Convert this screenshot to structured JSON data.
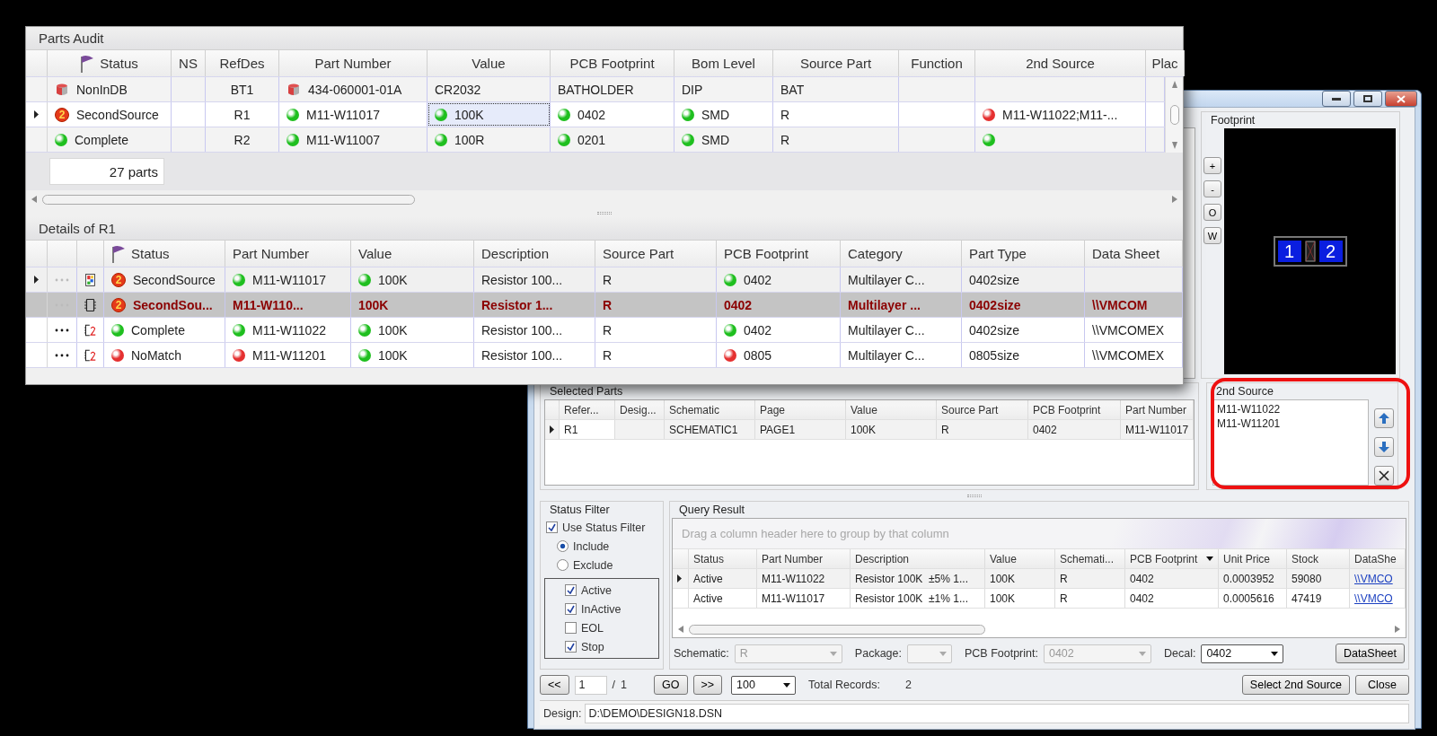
{
  "audit": {
    "title": "Parts Audit",
    "columns": [
      "Status",
      "NS",
      "RefDes",
      "Part Number",
      "Value",
      "PCB Footprint",
      "Bom Level",
      "Source Part",
      "Function",
      "2nd Source",
      "Plac"
    ],
    "rows": [
      {
        "current": false,
        "cells": [
          {
            "kind": "db",
            "text": "NonInDB"
          },
          null,
          {
            "text": "BT1"
          },
          {
            "kind": "db",
            "text": "434-060001-01A"
          },
          {
            "text": "CR2032"
          },
          {
            "text": "BATHOLDER"
          },
          {
            "text": "DIP"
          },
          {
            "text": "BAT"
          },
          null,
          null
        ]
      },
      {
        "current": true,
        "cells": [
          {
            "kind": "badge",
            "badge": "2",
            "text": "SecondSource"
          },
          null,
          {
            "text": "R1"
          },
          {
            "kind": "ok",
            "text": "M11-W11017"
          },
          {
            "kind": "ok",
            "text": "100K",
            "focused": true
          },
          {
            "kind": "ok",
            "text": "0402"
          },
          {
            "kind": "ok",
            "text": "SMD"
          },
          {
            "text": "R"
          },
          null,
          {
            "kind": "bad",
            "text": "M11-W11022;M11-..."
          }
        ]
      },
      {
        "current": false,
        "cells": [
          {
            "kind": "ok",
            "text": "Complete"
          },
          null,
          {
            "text": "R2"
          },
          {
            "kind": "ok",
            "text": "M11-W11007"
          },
          {
            "kind": "ok",
            "text": "100R"
          },
          {
            "kind": "ok",
            "text": "0201"
          },
          {
            "kind": "ok",
            "text": "SMD"
          },
          {
            "text": "R"
          },
          null,
          {
            "kind": "ok"
          }
        ]
      }
    ],
    "count": "27 parts"
  },
  "details": {
    "title": "Details of R1",
    "columns": [
      "Status",
      "Part Number",
      "Value",
      "Description",
      "Source Part",
      "PCB Footprint",
      "Category",
      "Part Type",
      "Data Sheet"
    ],
    "rows": [
      {
        "current": true,
        "selected": false,
        "dots_active": false,
        "kind": "multi",
        "cells": [
          {
            "kind": "badge",
            "badge": "2",
            "text": "SecondSource"
          },
          {
            "kind": "ok",
            "text": "M11-W11017"
          },
          {
            "kind": "ok",
            "text": "100K"
          },
          {
            "text": "Resistor 100..."
          },
          {
            "text": "R"
          },
          {
            "kind": "ok",
            "text": "0402"
          },
          {
            "text": "Multilayer C..."
          },
          {
            "text": "0402size"
          },
          null
        ]
      },
      {
        "current": false,
        "selected": true,
        "dots_active": false,
        "kind": "chip",
        "cells": [
          {
            "kind": "badge",
            "badge": "2",
            "text": "SecondSou..."
          },
          {
            "text": "M11-W110..."
          },
          {
            "text": "100K"
          },
          {
            "text": "Resistor 1..."
          },
          {
            "text": "R"
          },
          {
            "text": "0402"
          },
          {
            "text": "Multilayer ..."
          },
          {
            "text": "0402size"
          },
          {
            "text": "\\\\VMCOM"
          }
        ]
      },
      {
        "current": false,
        "selected": false,
        "dots_active": true,
        "kind": "chip2",
        "cells": [
          {
            "kind": "ok",
            "text": "Complete"
          },
          {
            "kind": "ok",
            "text": "M11-W11022"
          },
          {
            "kind": "ok",
            "text": "100K"
          },
          {
            "text": "Resistor 100..."
          },
          {
            "text": "R"
          },
          {
            "kind": "ok",
            "text": "0402"
          },
          {
            "text": "Multilayer C..."
          },
          {
            "text": "0402size"
          },
          {
            "text": "\\\\VMCOMEX"
          }
        ]
      },
      {
        "current": false,
        "selected": false,
        "dots_active": true,
        "kind": "chip2",
        "cells": [
          {
            "kind": "bad",
            "text": "NoMatch"
          },
          {
            "kind": "bad",
            "text": "M11-W11201"
          },
          {
            "kind": "ok",
            "text": "100K"
          },
          {
            "text": "Resistor 100..."
          },
          {
            "text": "R"
          },
          {
            "kind": "bad",
            "text": "0805"
          },
          {
            "text": "Multilayer C..."
          },
          {
            "text": "0805size"
          },
          {
            "text": "\\\\VMCOMEX"
          }
        ]
      }
    ]
  },
  "dialog": {
    "footprint": {
      "title": "Footprint",
      "zoom_buttons": [
        "+",
        "-",
        "O",
        "W"
      ],
      "pads": [
        "1",
        "2"
      ]
    },
    "selected_parts": {
      "title": "Selected Parts",
      "columns": [
        "Refer...",
        "Desig...",
        "Schematic",
        "Page",
        "Value",
        "Source Part",
        "PCB Footprint",
        "Part Number"
      ],
      "rows": [
        {
          "current": true,
          "cells": [
            "R1",
            null,
            "SCHEMATIC1",
            "PAGE1",
            "100K",
            "R",
            "0402",
            "M11-W11017"
          ]
        }
      ]
    },
    "second_source": {
      "title": "2nd Source",
      "items": [
        "M11-W11022",
        "M11-W11201"
      ]
    },
    "status_filter": {
      "title": "Status Filter",
      "use_filter": {
        "label": "Use Status Filter",
        "checked": true
      },
      "modes": [
        {
          "label": "Include",
          "selected": true
        },
        {
          "label": "Exclude",
          "selected": false
        }
      ],
      "statuses": [
        {
          "label": "Active",
          "checked": true
        },
        {
          "label": "InActive",
          "checked": true
        },
        {
          "label": "EOL",
          "checked": false
        },
        {
          "label": "Stop",
          "checked": true
        }
      ]
    },
    "query": {
      "title": "Query Result",
      "group_hint": "Drag a column header here to group by that column",
      "columns": [
        "Status",
        "Part Number",
        "Description",
        "Value",
        "Schemati...",
        "PCB Footprint",
        "Unit Price",
        "Stock",
        "DataShe"
      ],
      "rows": [
        {
          "current": true,
          "cells": [
            "Active",
            "M11-W11022",
            "Resistor 100K  ±5% 1...",
            "100K",
            "R",
            "0402",
            "0.0003952",
            "59080",
            "\\\\VMCO"
          ]
        },
        {
          "current": false,
          "cells": [
            "Active",
            "M11-W11017",
            "Resistor 100K  ±1% 1...",
            "100K",
            "R",
            "0402",
            "0.0005616",
            "47419",
            "\\\\VMCO"
          ]
        }
      ]
    },
    "filters": [
      {
        "label": "Schematic:",
        "value": "R",
        "disabled": true
      },
      {
        "label": "Package:",
        "disabled": true
      },
      {
        "label": "PCB Footprint:",
        "value": "0402",
        "disabled": true
      },
      {
        "label": "Decal:",
        "value": "0402",
        "disabled": false
      }
    ],
    "datasheet_button": "DataSheet",
    "pager": {
      "first": "<<",
      "page": "1",
      "sep": "/",
      "pages": "1",
      "go": "GO",
      "next": ">>",
      "page_size": "100",
      "total_label": "Total Records:",
      "total": "2"
    },
    "actions": [
      "Select 2nd Source",
      "Close"
    ],
    "design": {
      "label": "Design:",
      "value": "D:\\DEMO\\DESIGN18.DSN"
    }
  }
}
